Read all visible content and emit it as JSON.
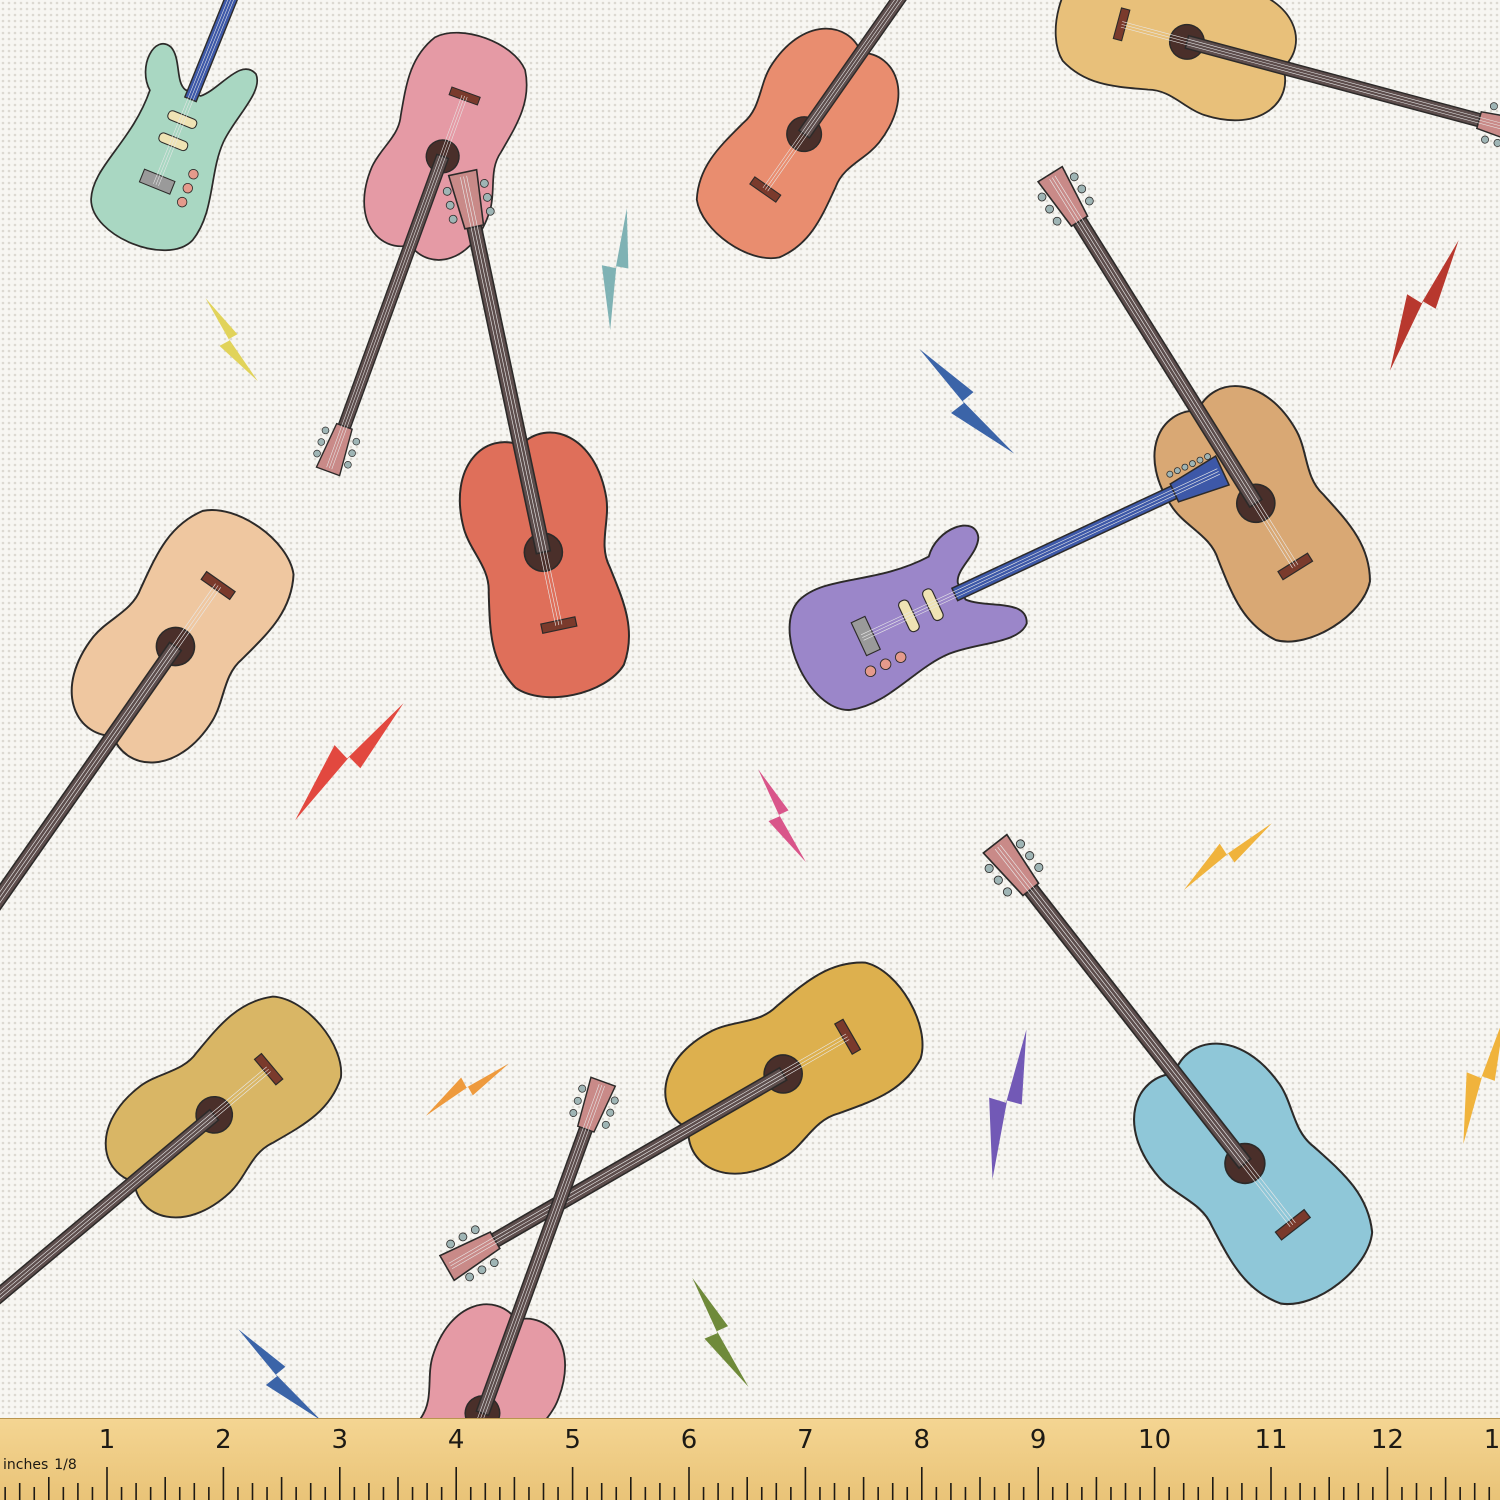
{
  "fabric": {
    "background": "#f7f6f2",
    "guitars": [
      {
        "kind": "electric",
        "color": "#a9d7c2"
      },
      {
        "kind": "acoustic",
        "color": "#e59aa5"
      },
      {
        "kind": "acoustic",
        "color": "#e98d6f"
      },
      {
        "kind": "acoustic",
        "color": "#e8c07a"
      },
      {
        "kind": "acoustic",
        "color": "#d9a874"
      },
      {
        "kind": "acoustic",
        "color": "#efc7a0"
      },
      {
        "kind": "acoustic",
        "color": "#df6f5a"
      },
      {
        "kind": "electric",
        "color": "#9b86c9"
      },
      {
        "kind": "acoustic",
        "color": "#d9b665"
      },
      {
        "kind": "acoustic",
        "color": "#ddb04e"
      },
      {
        "kind": "acoustic",
        "color": "#8fc7d8"
      },
      {
        "kind": "acoustic",
        "color": "#e59aa5"
      }
    ],
    "bolts": [
      {
        "color": "#e1d35a"
      },
      {
        "color": "#7fb2b4"
      },
      {
        "color": "#3b64a8"
      },
      {
        "color": "#b8382e"
      },
      {
        "color": "#e2483f"
      },
      {
        "color": "#d9558a"
      },
      {
        "color": "#f0b33c"
      },
      {
        "color": "#ee9a3d"
      },
      {
        "color": "#7259b6"
      },
      {
        "color": "#6f8a3a"
      },
      {
        "color": "#3b64a8"
      },
      {
        "color": "#f0b33c"
      }
    ]
  },
  "ruler": {
    "unit_label": "inches",
    "fraction_label": "1/8",
    "numbers": [
      "1",
      "2",
      "3",
      "4",
      "5",
      "6",
      "7",
      "8",
      "9",
      "10",
      "11",
      "12",
      "1"
    ]
  }
}
